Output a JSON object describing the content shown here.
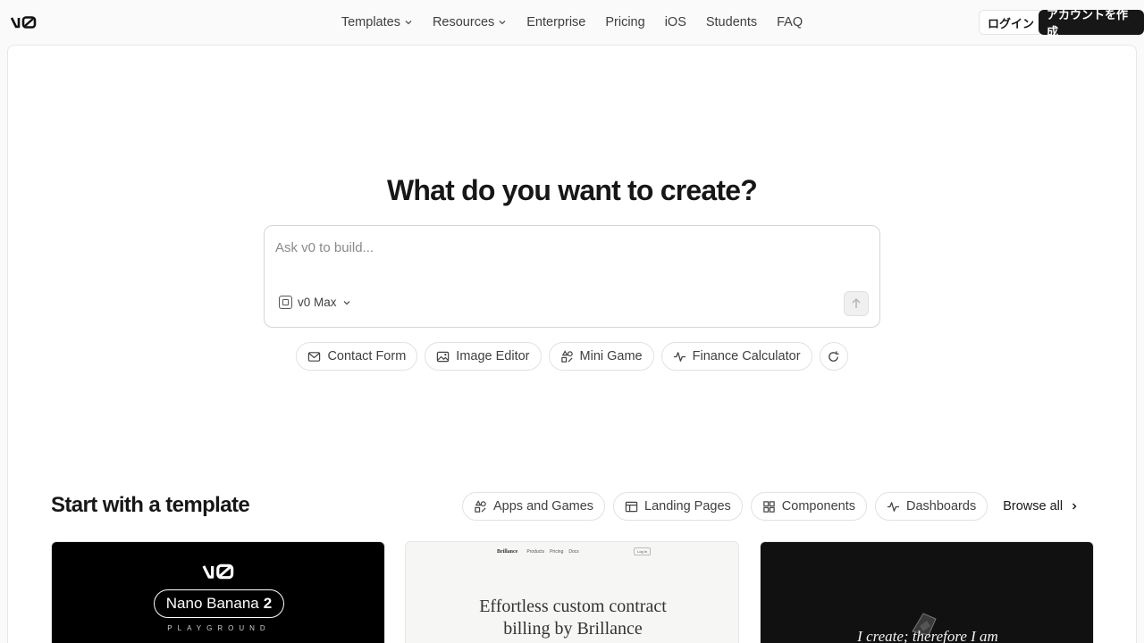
{
  "header": {
    "logo": "v0",
    "nav": [
      {
        "label": "Templates",
        "has_dropdown": true
      },
      {
        "label": "Resources",
        "has_dropdown": true
      },
      {
        "label": "Enterprise",
        "has_dropdown": false
      },
      {
        "label": "Pricing",
        "has_dropdown": false
      },
      {
        "label": "iOS",
        "has_dropdown": false
      },
      {
        "label": "Students",
        "has_dropdown": false
      },
      {
        "label": "FAQ",
        "has_dropdown": false
      }
    ],
    "login_label": "ログイン",
    "signup_label": "アカウントを作成"
  },
  "hero": {
    "title": "What do you want to create?",
    "prompt_placeholder": "Ask v0 to build...",
    "model": "v0 Max",
    "suggestions": [
      {
        "label": "Contact Form",
        "icon": "mail-icon"
      },
      {
        "label": "Image Editor",
        "icon": "image-icon"
      },
      {
        "label": "Mini Game",
        "icon": "shapes-icon"
      },
      {
        "label": "Finance Calculator",
        "icon": "activity-icon"
      }
    ]
  },
  "templates": {
    "title": "Start with a template",
    "filters": [
      {
        "label": "Apps and Games",
        "icon": "shapes-icon"
      },
      {
        "label": "Landing Pages",
        "icon": "layout-icon"
      },
      {
        "label": "Components",
        "icon": "grid-icon"
      },
      {
        "label": "Dashboards",
        "icon": "activity-icon"
      }
    ],
    "browse_label": "Browse all",
    "cards": {
      "card1": {
        "logo": "v0",
        "name": "Nano Banana",
        "number": "2",
        "sub": "PLAYGROUND"
      },
      "card2": {
        "brand": "Brillance",
        "nav": [
          "Products",
          "Pricing",
          "Docs"
        ],
        "button": "Log in",
        "line1": "Effortless custom contract",
        "line2": "billing by Brillance"
      },
      "card3": {
        "text": "I create; therefore I am"
      }
    }
  },
  "colors": {
    "accent": "#171717",
    "background": "#fafafa",
    "panel": "#ffffff",
    "border": "#e2e2e2"
  }
}
